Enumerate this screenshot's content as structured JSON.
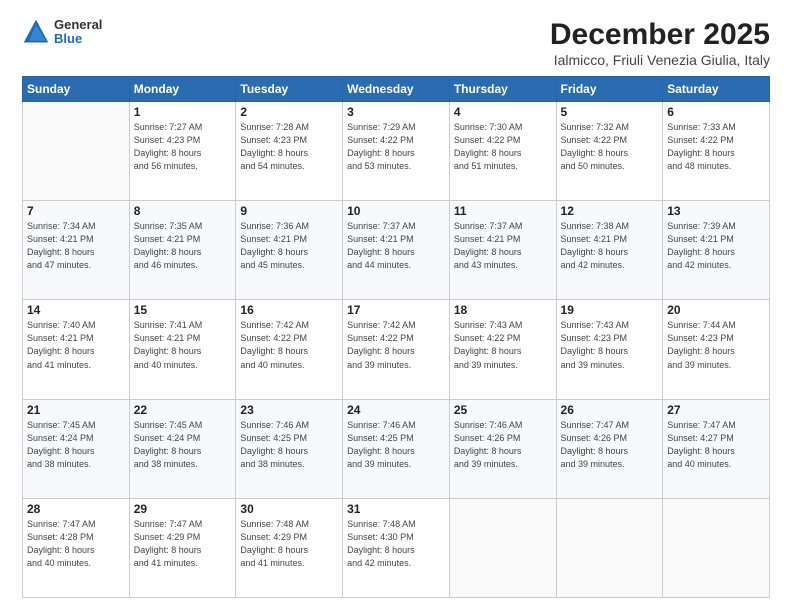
{
  "logo": {
    "general": "General",
    "blue": "Blue"
  },
  "title": "December 2025",
  "subtitle": "Ialmicco, Friuli Venezia Giulia, Italy",
  "days_header": [
    "Sunday",
    "Monday",
    "Tuesday",
    "Wednesday",
    "Thursday",
    "Friday",
    "Saturday"
  ],
  "weeks": [
    [
      {
        "day": "",
        "info": ""
      },
      {
        "day": "1",
        "info": "Sunrise: 7:27 AM\nSunset: 4:23 PM\nDaylight: 8 hours\nand 56 minutes."
      },
      {
        "day": "2",
        "info": "Sunrise: 7:28 AM\nSunset: 4:23 PM\nDaylight: 8 hours\nand 54 minutes."
      },
      {
        "day": "3",
        "info": "Sunrise: 7:29 AM\nSunset: 4:22 PM\nDaylight: 8 hours\nand 53 minutes."
      },
      {
        "day": "4",
        "info": "Sunrise: 7:30 AM\nSunset: 4:22 PM\nDaylight: 8 hours\nand 51 minutes."
      },
      {
        "day": "5",
        "info": "Sunrise: 7:32 AM\nSunset: 4:22 PM\nDaylight: 8 hours\nand 50 minutes."
      },
      {
        "day": "6",
        "info": "Sunrise: 7:33 AM\nSunset: 4:22 PM\nDaylight: 8 hours\nand 48 minutes."
      }
    ],
    [
      {
        "day": "7",
        "info": "Sunrise: 7:34 AM\nSunset: 4:21 PM\nDaylight: 8 hours\nand 47 minutes."
      },
      {
        "day": "8",
        "info": "Sunrise: 7:35 AM\nSunset: 4:21 PM\nDaylight: 8 hours\nand 46 minutes."
      },
      {
        "day": "9",
        "info": "Sunrise: 7:36 AM\nSunset: 4:21 PM\nDaylight: 8 hours\nand 45 minutes."
      },
      {
        "day": "10",
        "info": "Sunrise: 7:37 AM\nSunset: 4:21 PM\nDaylight: 8 hours\nand 44 minutes."
      },
      {
        "day": "11",
        "info": "Sunrise: 7:37 AM\nSunset: 4:21 PM\nDaylight: 8 hours\nand 43 minutes."
      },
      {
        "day": "12",
        "info": "Sunrise: 7:38 AM\nSunset: 4:21 PM\nDaylight: 8 hours\nand 42 minutes."
      },
      {
        "day": "13",
        "info": "Sunrise: 7:39 AM\nSunset: 4:21 PM\nDaylight: 8 hours\nand 42 minutes."
      }
    ],
    [
      {
        "day": "14",
        "info": "Sunrise: 7:40 AM\nSunset: 4:21 PM\nDaylight: 8 hours\nand 41 minutes."
      },
      {
        "day": "15",
        "info": "Sunrise: 7:41 AM\nSunset: 4:21 PM\nDaylight: 8 hours\nand 40 minutes."
      },
      {
        "day": "16",
        "info": "Sunrise: 7:42 AM\nSunset: 4:22 PM\nDaylight: 8 hours\nand 40 minutes."
      },
      {
        "day": "17",
        "info": "Sunrise: 7:42 AM\nSunset: 4:22 PM\nDaylight: 8 hours\nand 39 minutes."
      },
      {
        "day": "18",
        "info": "Sunrise: 7:43 AM\nSunset: 4:22 PM\nDaylight: 8 hours\nand 39 minutes."
      },
      {
        "day": "19",
        "info": "Sunrise: 7:43 AM\nSunset: 4:23 PM\nDaylight: 8 hours\nand 39 minutes."
      },
      {
        "day": "20",
        "info": "Sunrise: 7:44 AM\nSunset: 4:23 PM\nDaylight: 8 hours\nand 39 minutes."
      }
    ],
    [
      {
        "day": "21",
        "info": "Sunrise: 7:45 AM\nSunset: 4:24 PM\nDaylight: 8 hours\nand 38 minutes."
      },
      {
        "day": "22",
        "info": "Sunrise: 7:45 AM\nSunset: 4:24 PM\nDaylight: 8 hours\nand 38 minutes."
      },
      {
        "day": "23",
        "info": "Sunrise: 7:46 AM\nSunset: 4:25 PM\nDaylight: 8 hours\nand 38 minutes."
      },
      {
        "day": "24",
        "info": "Sunrise: 7:46 AM\nSunset: 4:25 PM\nDaylight: 8 hours\nand 39 minutes."
      },
      {
        "day": "25",
        "info": "Sunrise: 7:46 AM\nSunset: 4:26 PM\nDaylight: 8 hours\nand 39 minutes."
      },
      {
        "day": "26",
        "info": "Sunrise: 7:47 AM\nSunset: 4:26 PM\nDaylight: 8 hours\nand 39 minutes."
      },
      {
        "day": "27",
        "info": "Sunrise: 7:47 AM\nSunset: 4:27 PM\nDaylight: 8 hours\nand 40 minutes."
      }
    ],
    [
      {
        "day": "28",
        "info": "Sunrise: 7:47 AM\nSunset: 4:28 PM\nDaylight: 8 hours\nand 40 minutes."
      },
      {
        "day": "29",
        "info": "Sunrise: 7:47 AM\nSunset: 4:29 PM\nDaylight: 8 hours\nand 41 minutes."
      },
      {
        "day": "30",
        "info": "Sunrise: 7:48 AM\nSunset: 4:29 PM\nDaylight: 8 hours\nand 41 minutes."
      },
      {
        "day": "31",
        "info": "Sunrise: 7:48 AM\nSunset: 4:30 PM\nDaylight: 8 hours\nand 42 minutes."
      },
      {
        "day": "",
        "info": ""
      },
      {
        "day": "",
        "info": ""
      },
      {
        "day": "",
        "info": ""
      }
    ]
  ]
}
